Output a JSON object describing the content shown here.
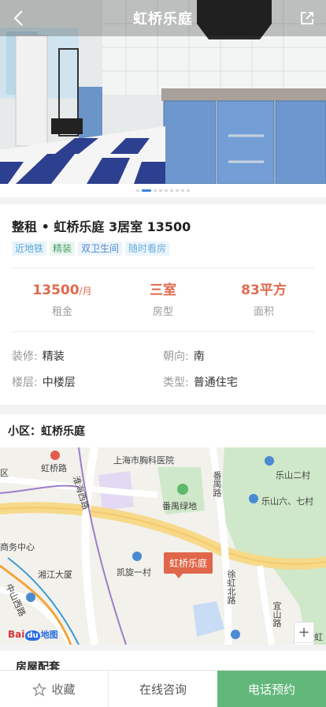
{
  "header": {
    "title": "虹桥乐庭"
  },
  "gallery": {
    "total_dots": 10,
    "active_index": 1
  },
  "listing": {
    "title": "整租 • 虹桥乐庭 3居室 13500",
    "tags": [
      "近地铁",
      "精装",
      "双卫生间",
      "随时看房"
    ],
    "stats": [
      {
        "value": "13500",
        "unit": "/月",
        "label": "租金"
      },
      {
        "value": "三室",
        "unit": "",
        "label": "房型"
      },
      {
        "value": "83平方",
        "unit": "",
        "label": "面积"
      }
    ],
    "attributes": [
      {
        "key": "装修:",
        "value": "精装"
      },
      {
        "key": "朝向:",
        "value": "南"
      },
      {
        "key": "楼层:",
        "value": "中楼层"
      },
      {
        "key": "类型:",
        "value": "普通住宅"
      }
    ]
  },
  "community": {
    "title": "小区：虹桥乐庭",
    "map": {
      "marker": "虹桥乐庭",
      "labels": {
        "hongqiao_road": "虹桥路",
        "chest_hospital": "上海市胸科医院",
        "fanyu_road": "番禺路",
        "fanyu_green": "番禺绿地",
        "leshan_2": "乐山二村",
        "leshan_67": "乐山六、七村",
        "huaihai_west": "淮海西路",
        "xiangjiang": "湘江大厦",
        "kaixuan_1": "凯旋一村",
        "business_center": "商务中心",
        "zhongshan_west": "中山西路",
        "xuhui_north": "徐虹北路",
        "yishan": "宜山路",
        "nanyi": "南虹",
        "qu": "区"
      },
      "zoom_in": "+",
      "zoom_out": "−",
      "logo_bai": "Bai",
      "logo_du": "du",
      "logo_ditu": "地图"
    }
  },
  "next_section": {
    "title": "房屋配套"
  },
  "bottom_bar": {
    "favorite": "收藏",
    "consult": "在线咨询",
    "call": "电话预约"
  }
}
